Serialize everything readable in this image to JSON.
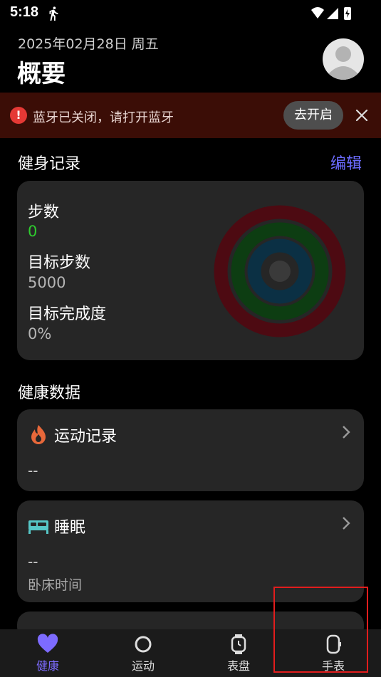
{
  "status_bar": {
    "time": "5:18",
    "icons": [
      "running-icon",
      "wifi-icon",
      "signal-icon",
      "battery-icon"
    ]
  },
  "header": {
    "date": "2025年02月28日 周五",
    "title": "概要"
  },
  "banner": {
    "message": "蓝牙已关闭，请打开蓝牙",
    "button_label": "去开启",
    "accent": "#e53935"
  },
  "fitness": {
    "section_title": "健身记录",
    "edit_label": "编辑",
    "steps_label": "步数",
    "steps_value": "0",
    "goal_label": "目标步数",
    "goal_value": "5000",
    "completion_label": "目标完成度",
    "completion_value": "0%"
  },
  "health": {
    "section_title": "健康数据",
    "items": [
      {
        "icon": "fire-icon",
        "label": "运动记录",
        "value": "--"
      },
      {
        "icon": "bed-icon",
        "label": "睡眠",
        "value": "--",
        "sub": "卧床时间"
      }
    ]
  },
  "tabbar": {
    "tabs": [
      {
        "icon": "heart-icon",
        "label": "健康",
        "active": true
      },
      {
        "icon": "ring-icon",
        "label": "运动"
      },
      {
        "icon": "watch-face-icon",
        "label": "表盘"
      },
      {
        "icon": "watch-icon",
        "label": "手表"
      }
    ],
    "active_color": "#7d6bff"
  }
}
